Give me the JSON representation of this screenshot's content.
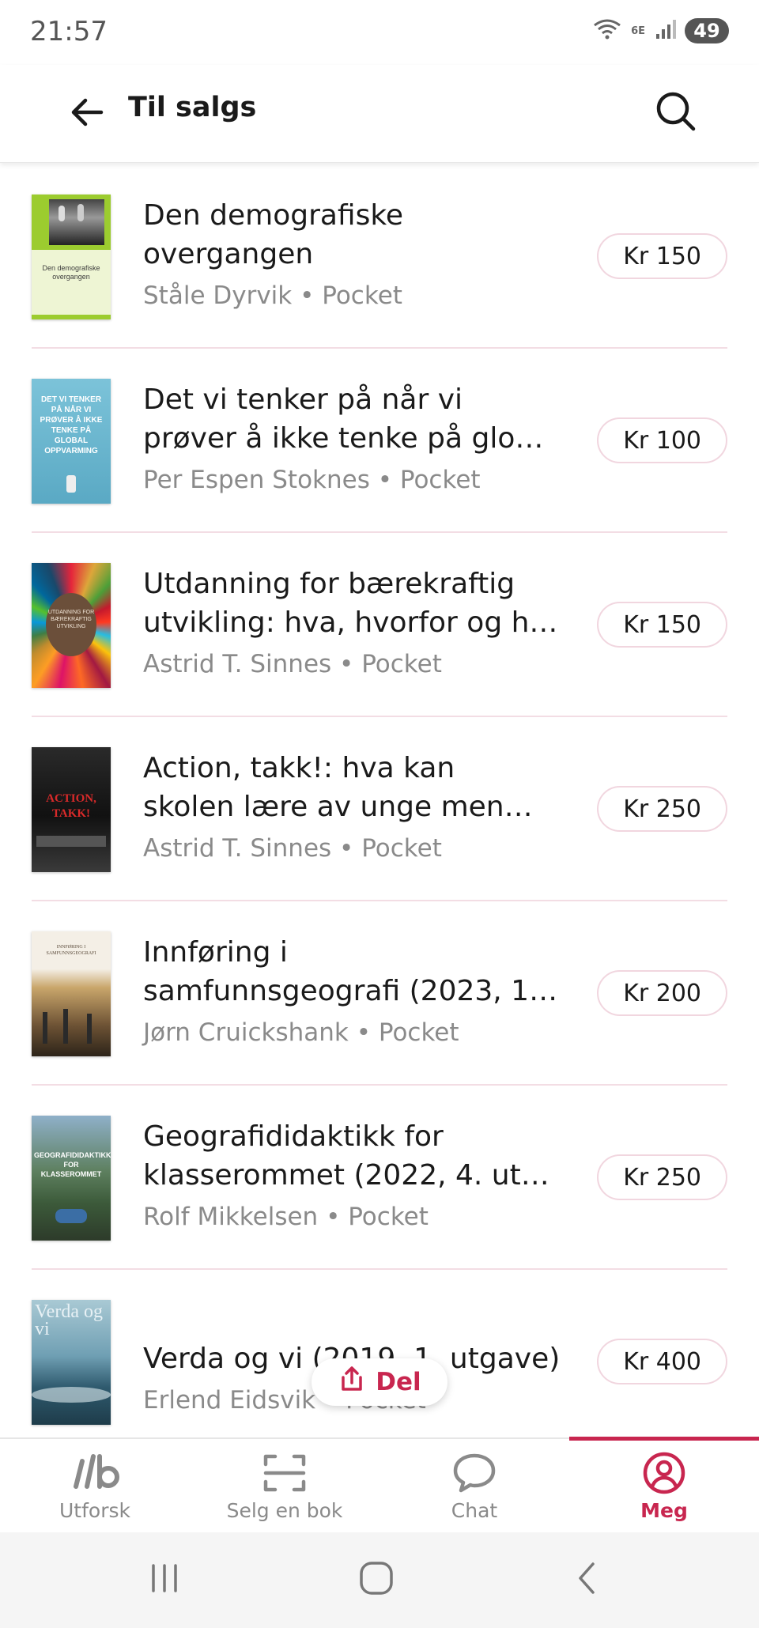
{
  "status_bar": {
    "time": "21:57",
    "network": "6E",
    "battery": "49"
  },
  "app_bar": {
    "title": "Til salgs"
  },
  "books": [
    {
      "title_lines": [
        "Den demografiske",
        "overgangen"
      ],
      "author": "Ståle Dyrvik",
      "format": "Pocket",
      "price": "Kr 150",
      "cover_text": "Den demografiske overgangen"
    },
    {
      "title_lines": [
        "Det vi tenker på når vi",
        "prøver å ikke tenke på glo…"
      ],
      "author": "Per Espen Stoknes",
      "format": "Pocket",
      "price": "Kr 100",
      "cover_text": "DET VI TENKER PÅ NÅR VI PRØVER Å IKKE TENKE PÅ GLOBAL OPPVARMING"
    },
    {
      "title_lines": [
        "Utdanning for bærekraftig",
        "utvikling: hva, hvorfor og h…"
      ],
      "author": "Astrid T. Sinnes",
      "format": "Pocket",
      "price": "Kr 150",
      "cover_text": "UTDANNING FOR BÆREKRAFTIG UTVIKLING"
    },
    {
      "title_lines": [
        "Action, takk!: hva kan",
        "skolen lære av unge men…"
      ],
      "author": "Astrid T. Sinnes",
      "format": "Pocket",
      "price": "Kr 250",
      "cover_text": "ACTION, TAKK!"
    },
    {
      "title_lines": [
        "Innføring i",
        "samfunnsgeografi (2023, 1…"
      ],
      "author": "Jørn Cruickshank",
      "format": "Pocket",
      "price": "Kr 200",
      "cover_text": "INNFØRING I SAMFUNNSGEOGRAFI"
    },
    {
      "title_lines": [
        "Geografididaktikk for",
        "klasserommet (2022, 4. ut…"
      ],
      "author": "Rolf Mikkelsen",
      "format": "Pocket",
      "price": "Kr 250",
      "cover_text": "GEOGRAFIDIDAKTIKK FOR KLASSEROMMET"
    },
    {
      "title_lines": [
        "Verda og vi (2019, 1. utgave)"
      ],
      "author": "Erlend Eidsvik",
      "format": "Pocket",
      "price": "Kr 400",
      "cover_text": "Verda og vi"
    }
  ],
  "share_button": {
    "label": "Del"
  },
  "bottom_nav": [
    {
      "label": "Utforsk",
      "icon": "explore-logo-icon"
    },
    {
      "label": "Selg en bok",
      "icon": "scan-icon"
    },
    {
      "label": "Chat",
      "icon": "chat-bubble-icon"
    },
    {
      "label": "Meg",
      "icon": "profile-icon",
      "active": true
    }
  ],
  "colors": {
    "accent": "#c8264f",
    "pill_border": "#f1d6df",
    "divider": "#f3dde4",
    "muted_text": "#8a8a8a"
  }
}
